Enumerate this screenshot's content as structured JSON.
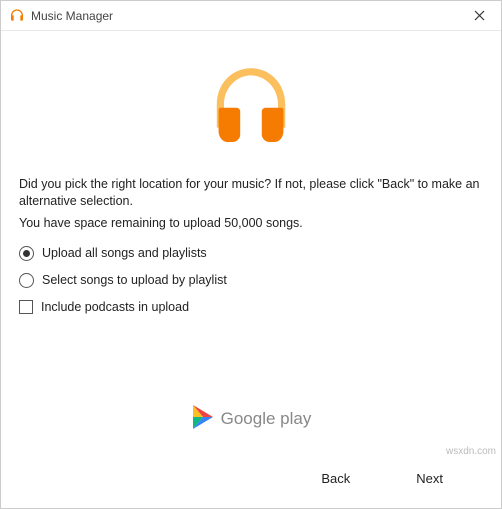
{
  "window": {
    "title": "Music Manager"
  },
  "content": {
    "prompt": "Did you pick the right location for your music? If not, please click \"Back\" to make an alternative selection.",
    "status": "You have space remaining to upload 50,000 songs.",
    "options": {
      "upload_all": "Upload all songs and playlists",
      "select_by_playlist": "Select songs to upload by playlist",
      "include_podcasts": "Include podcasts in upload"
    }
  },
  "footer": {
    "brand": "Google play",
    "back": "Back",
    "next": "Next"
  },
  "watermark": "wsxdn.com"
}
